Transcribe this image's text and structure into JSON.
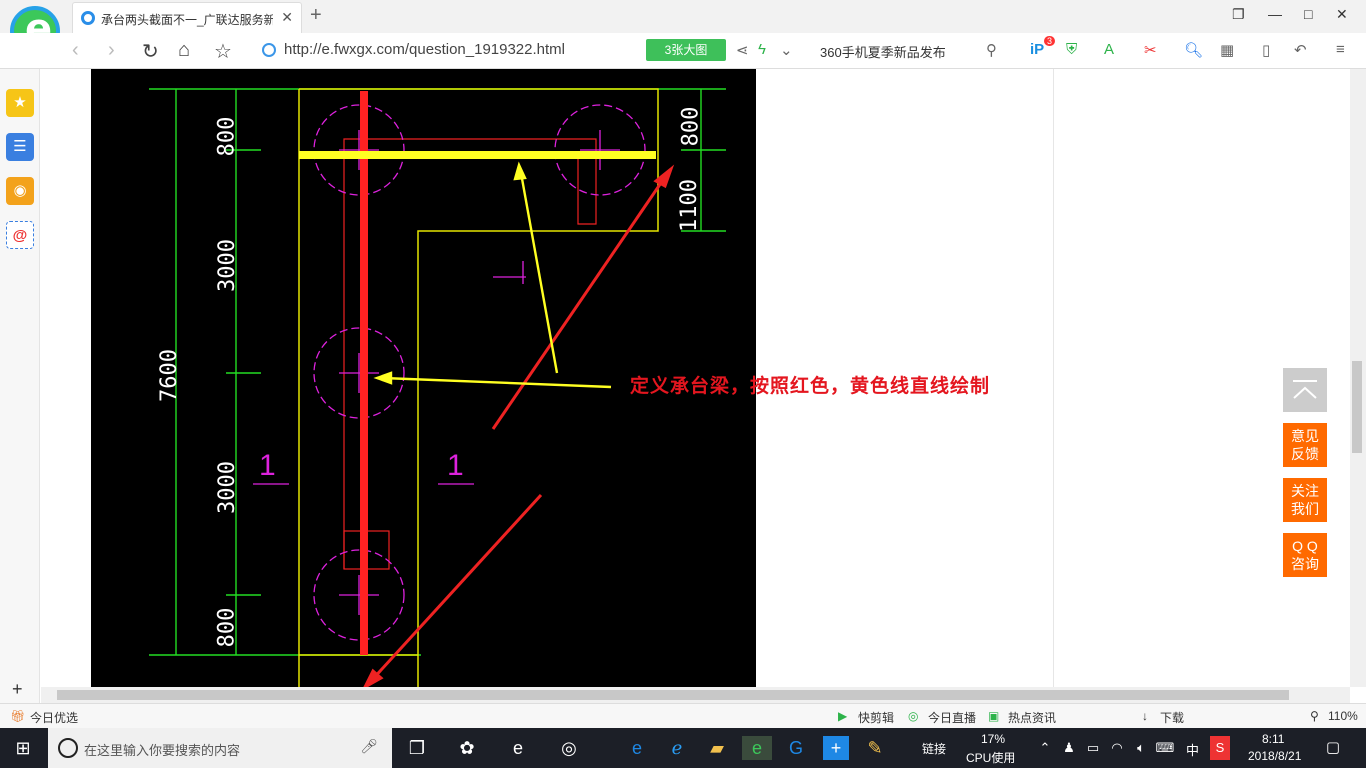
{
  "browser": {
    "tab_title": "承台两头截面不一_广联达服务新",
    "new_tab": "+",
    "url": "http://e.fwxgx.com/question_1919322.html",
    "bigpic_label": "3张大图",
    "search_hint": "360手机夏季新品发布",
    "badge_count": "3",
    "win_controls": {
      "restore": "❐",
      "minimize": "—",
      "maximize": "□",
      "close": "✕"
    }
  },
  "cad": {
    "dimensions_left": [
      "800",
      "3000",
      "3000",
      "800"
    ],
    "dimension_total": "7600",
    "dimensions_right": [
      "800",
      "1100"
    ],
    "section_marks": [
      "1",
      "1",
      "1"
    ],
    "annotation": "定义承台梁，按照红色，黄色线直线绘制",
    "colors": {
      "red": "#ff2222",
      "yellow": "#ffff22",
      "green": "#22dd22",
      "magenta": "#dd22dd",
      "line_yellow": "#e6e600"
    }
  },
  "floating": {
    "feedback": "意见反馈",
    "follow": "关注我们",
    "qq": "Q Q咨询"
  },
  "statusbar": {
    "left": "今日优选",
    "items": [
      "快剪辑",
      "今日直播",
      "热点资讯",
      "下载"
    ],
    "zoom": "110%"
  },
  "taskbar": {
    "search_placeholder": "在这里输入你要搜索的内容",
    "link_label": "链接",
    "cpu_percent": "17%",
    "cpu_label": "CPU使用",
    "ime": "中",
    "time": "8:11",
    "date": "2018/8/21"
  }
}
